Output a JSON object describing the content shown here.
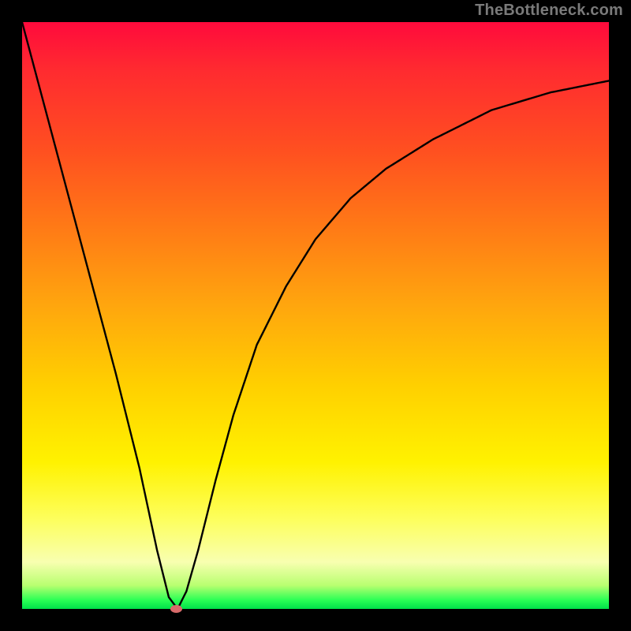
{
  "watermark": "TheBottleneck.com",
  "chart_data": {
    "type": "line",
    "title": "",
    "xlabel": "",
    "ylabel": "",
    "xlim": [
      0,
      100
    ],
    "ylim": [
      0,
      100
    ],
    "grid": false,
    "legend": false,
    "background_gradient": {
      "top": "#ff0a3c",
      "mid_upper": "#ff7a16",
      "mid": "#ffd000",
      "mid_lower": "#fdff60",
      "bottom": "#00e04a"
    },
    "series": [
      {
        "name": "bottleneck-curve",
        "color": "#000000",
        "x": [
          0,
          4,
          8,
          12,
          16,
          20,
          23,
          25,
          26.5,
          28,
          30,
          33,
          36,
          40,
          45,
          50,
          56,
          62,
          70,
          80,
          90,
          100
        ],
        "y": [
          100,
          85,
          70,
          55,
          40,
          24,
          10,
          2,
          0,
          3,
          10,
          22,
          33,
          45,
          55,
          63,
          70,
          75,
          80,
          85,
          88,
          90
        ]
      }
    ],
    "marker": {
      "x": 26.3,
      "y": 0,
      "color": "#d86a6a"
    }
  }
}
